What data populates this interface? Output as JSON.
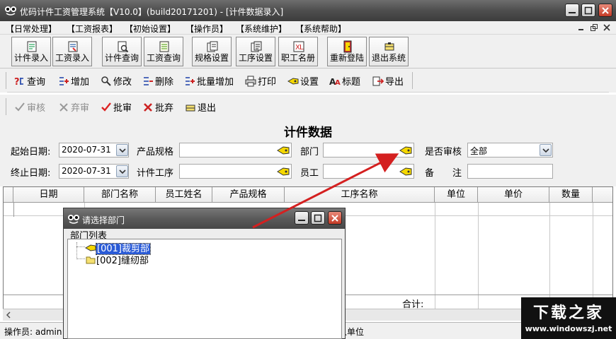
{
  "window": {
    "title": "优码计件工资管理系统【V10.0】(build20171201) - [计件数据录入]"
  },
  "menu": [
    "【日常处理】",
    "【工资报表】",
    "【初始设置】",
    "【操作员】",
    "【系统维护】",
    "【系统帮助】"
  ],
  "toolbar_main": [
    {
      "label": "计件录入",
      "icon": "piece-entry-icon"
    },
    {
      "label": "工资录入",
      "icon": "wage-entry-icon"
    },
    {
      "label": "计件查询",
      "icon": "piece-query-icon"
    },
    {
      "label": "工资查询",
      "icon": "wage-query-icon"
    },
    {
      "label": "规格设置",
      "icon": "spec-settings-icon"
    },
    {
      "label": "工序设置",
      "icon": "process-settings-icon"
    },
    {
      "label": "职工名册",
      "icon": "staff-roster-icon"
    },
    {
      "label": "重新登陆",
      "icon": "relogin-icon"
    },
    {
      "label": "退出系统",
      "icon": "exit-system-icon"
    }
  ],
  "toolbar_actions": [
    {
      "label": "查询",
      "icon": "query-icon"
    },
    {
      "label": "增加",
      "icon": "add-icon"
    },
    {
      "label": "修改",
      "icon": "edit-icon"
    },
    {
      "label": "删除",
      "icon": "delete-icon"
    },
    {
      "label": "批量增加",
      "icon": "batch-add-icon"
    },
    {
      "label": "打印",
      "icon": "print-icon"
    },
    {
      "label": "设置",
      "icon": "settings-icon"
    },
    {
      "label": "标题",
      "icon": "title-icon"
    },
    {
      "label": "导出",
      "icon": "export-icon"
    }
  ],
  "toolbar_review": [
    {
      "label": "审核",
      "icon": "approve-icon",
      "enabled": false
    },
    {
      "label": "弃审",
      "icon": "unapprove-icon",
      "enabled": false
    },
    {
      "label": "批审",
      "icon": "batch-approve-icon",
      "enabled": true
    },
    {
      "label": "批弃",
      "icon": "batch-unapprove-icon",
      "enabled": true
    },
    {
      "label": "退出",
      "icon": "exit-icon",
      "enabled": true
    }
  ],
  "form": {
    "title": "计件数据",
    "start_date_label": "起始日期:",
    "start_date": "2020-07-31",
    "end_date_label": "终止日期:",
    "end_date": "2020-07-31",
    "product_spec_label": "产品规格",
    "product_spec": "",
    "process_label": "计件工序",
    "process": "",
    "dept_label": "部门",
    "dept": "",
    "employee_label": "员工",
    "employee": "",
    "reviewed_label": "是否审核",
    "reviewed": "全部",
    "remark_label": "备　　注",
    "remark": ""
  },
  "grid": {
    "columns": [
      "日期",
      "部门名称",
      "员工姓名",
      "产品规格",
      "工序名称",
      "单位",
      "单价",
      "数量"
    ],
    "total_label": "合计:"
  },
  "status": {
    "operator": "操作员: admin",
    "unit": "人单位"
  },
  "dialog": {
    "title": "请选择部门",
    "list_label": "部门列表",
    "items": [
      {
        "label": "[001]裁剪部",
        "selected": true
      },
      {
        "label": "[002]缝纫部",
        "selected": false
      }
    ]
  },
  "watermark": {
    "main": "下载之家",
    "url": "www.windowszj.net"
  },
  "colors": {
    "titlebar": "#4e4e4e",
    "selection": "#2a5bd7",
    "arrow": "#d42020",
    "close_button": "#c43a26"
  }
}
